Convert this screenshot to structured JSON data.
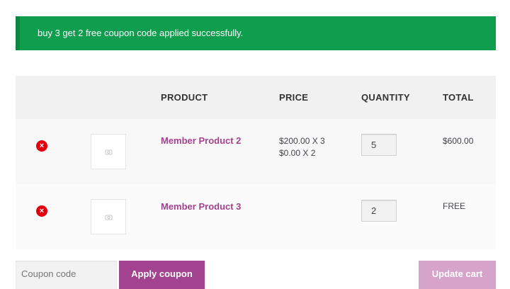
{
  "notice": {
    "message": "buy 3 get 2 free coupon code applied successfully."
  },
  "table": {
    "headers": {
      "product": "PRODUCT",
      "price": "PRICE",
      "quantity": "QUANTITY",
      "total": "TOTAL"
    },
    "rows": [
      {
        "remove_icon": "×",
        "name": "Member Product 2",
        "price_lines": [
          "$200.00 X 3",
          "$0.00 X 2"
        ],
        "quantity": "5",
        "total": "$600.00"
      },
      {
        "remove_icon": "×",
        "name": "Member Product 3",
        "price_lines": [],
        "quantity": "2",
        "total": "FREE"
      }
    ]
  },
  "actions": {
    "coupon_placeholder": "Coupon code",
    "apply_label": "Apply coupon",
    "update_label": "Update cart"
  },
  "colors": {
    "notice_bg": "#0f9d4e",
    "accent": "#a3428e",
    "accent_disabled": "#d6a4cb",
    "remove": "#e2000f"
  }
}
